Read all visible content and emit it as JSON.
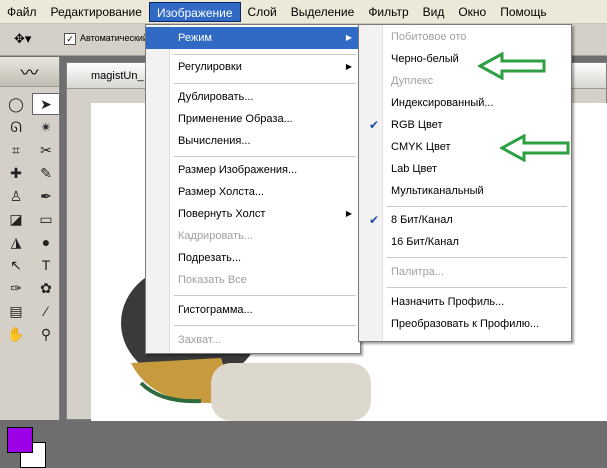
{
  "menubar": {
    "items": [
      "Файл",
      "Редактирование",
      "Изображение",
      "Слой",
      "Выделение",
      "Фильтр",
      "Вид",
      "Окно",
      "Помощь"
    ]
  },
  "options": {
    "auto_select_label": "Автоматический в"
  },
  "document": {
    "title": "magistUn_"
  },
  "image_menu": {
    "mode": "Режим",
    "adjust": "Регулировки",
    "duplicate": "Дублировать...",
    "apply_image": "Применение Образа...",
    "calculations": "Вычисления...",
    "image_size": "Размер Изображения...",
    "canvas_size": "Размер Холста...",
    "rotate_canvas": "Повернуть Холст",
    "crop": "Кадрировать...",
    "trim": "Подрезать...",
    "reveal_all": "Показать Все",
    "histogram": "Гистограмма...",
    "trap": "Захват..."
  },
  "mode_menu": {
    "bitmap": "Побитовое ото",
    "grayscale": "Черно-белый",
    "duotone": "Дуплекс",
    "indexed": "Индексированный...",
    "rgb": "RGB Цвет",
    "cmyk": "CMYK Цвет",
    "lab": "Lab Цвет",
    "multichannel": "Мультиканальный",
    "bits8": "8 Бит/Канал",
    "bits16": "16 Бит/Канал",
    "palette": "Палитра...",
    "assign_profile": "Назначить Профиль...",
    "convert_profile": "Преобразовать к Профилю..."
  },
  "colors": {
    "highlight": "#316ac5",
    "arrow": "#2ea043",
    "foreground": "#9b00e6"
  }
}
